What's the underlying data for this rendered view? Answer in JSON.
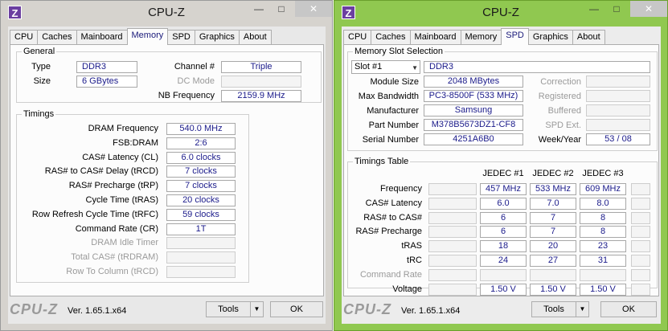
{
  "title": "CPU-Z",
  "window_buttons": {
    "minimize": "—",
    "maximize": "□",
    "close": "✕"
  },
  "tabs": [
    "CPU",
    "Caches",
    "Mainboard",
    "Memory",
    "SPD",
    "Graphics",
    "About"
  ],
  "footer": {
    "brand": "CPU-Z",
    "version": "Ver. 1.65.1.x64",
    "tools": "Tools",
    "ok": "OK"
  },
  "memory": {
    "general": {
      "title": "General",
      "type_label": "Type",
      "type": "DDR3",
      "size_label": "Size",
      "size": "6 GBytes",
      "channel_label": "Channel #",
      "channel": "Triple",
      "dc_mode_label": "DC Mode",
      "dc_mode": "",
      "nb_freq_label": "NB Frequency",
      "nb_freq": "2159.9 MHz"
    },
    "timings": {
      "title": "Timings",
      "rows": [
        {
          "label": "DRAM Frequency",
          "value": "540.0 MHz",
          "dim": false
        },
        {
          "label": "FSB:DRAM",
          "value": "2:6",
          "dim": false
        },
        {
          "label": "CAS# Latency (CL)",
          "value": "6.0 clocks",
          "dim": false
        },
        {
          "label": "RAS# to CAS# Delay (tRCD)",
          "value": "7 clocks",
          "dim": false
        },
        {
          "label": "RAS# Precharge (tRP)",
          "value": "7 clocks",
          "dim": false
        },
        {
          "label": "Cycle Time (tRAS)",
          "value": "20 clocks",
          "dim": false
        },
        {
          "label": "Row Refresh Cycle Time (tRFC)",
          "value": "59 clocks",
          "dim": false
        },
        {
          "label": "Command Rate (CR)",
          "value": "1T",
          "dim": false
        },
        {
          "label": "DRAM Idle Timer",
          "value": "",
          "dim": true
        },
        {
          "label": "Total CAS# (tRDRAM)",
          "value": "",
          "dim": true
        },
        {
          "label": "Row To Column (tRCD)",
          "value": "",
          "dim": true
        }
      ]
    }
  },
  "spd": {
    "slot_section": {
      "title": "Memory Slot Selection",
      "slot": "Slot #1",
      "type": "DDR3",
      "module_size_label": "Module Size",
      "module_size": "2048 MBytes",
      "max_bw_label": "Max Bandwidth",
      "max_bw": "PC3-8500F (533 MHz)",
      "manufacturer_label": "Manufacturer",
      "manufacturer": "Samsung",
      "part_label": "Part Number",
      "part": "M378B5673DZ1-CF8",
      "serial_label": "Serial Number",
      "serial": "4251A6B0",
      "correction_label": "Correction",
      "correction": "",
      "registered_label": "Registered",
      "registered": "",
      "buffered_label": "Buffered",
      "buffered": "",
      "spd_ext_label": "SPD Ext.",
      "spd_ext": "",
      "weekyear_label": "Week/Year",
      "weekyear": "53 / 08"
    },
    "timings_table": {
      "title": "Timings Table",
      "columns": [
        "JEDEC #1",
        "JEDEC #2",
        "JEDEC #3"
      ],
      "rows": [
        {
          "label": "Frequency",
          "values": [
            "457 MHz",
            "533 MHz",
            "609 MHz"
          ],
          "dim": false
        },
        {
          "label": "CAS# Latency",
          "values": [
            "6.0",
            "7.0",
            "8.0"
          ],
          "dim": false
        },
        {
          "label": "RAS# to CAS#",
          "values": [
            "6",
            "7",
            "8"
          ],
          "dim": false
        },
        {
          "label": "RAS# Precharge",
          "values": [
            "6",
            "7",
            "8"
          ],
          "dim": false
        },
        {
          "label": "tRAS",
          "values": [
            "18",
            "20",
            "23"
          ],
          "dim": false
        },
        {
          "label": "tRC",
          "values": [
            "24",
            "27",
            "31"
          ],
          "dim": false
        },
        {
          "label": "Command Rate",
          "values": [
            "",
            "",
            ""
          ],
          "dim": true
        },
        {
          "label": "Voltage",
          "values": [
            "1.50 V",
            "1.50 V",
            "1.50 V"
          ],
          "dim": false
        }
      ]
    }
  }
}
